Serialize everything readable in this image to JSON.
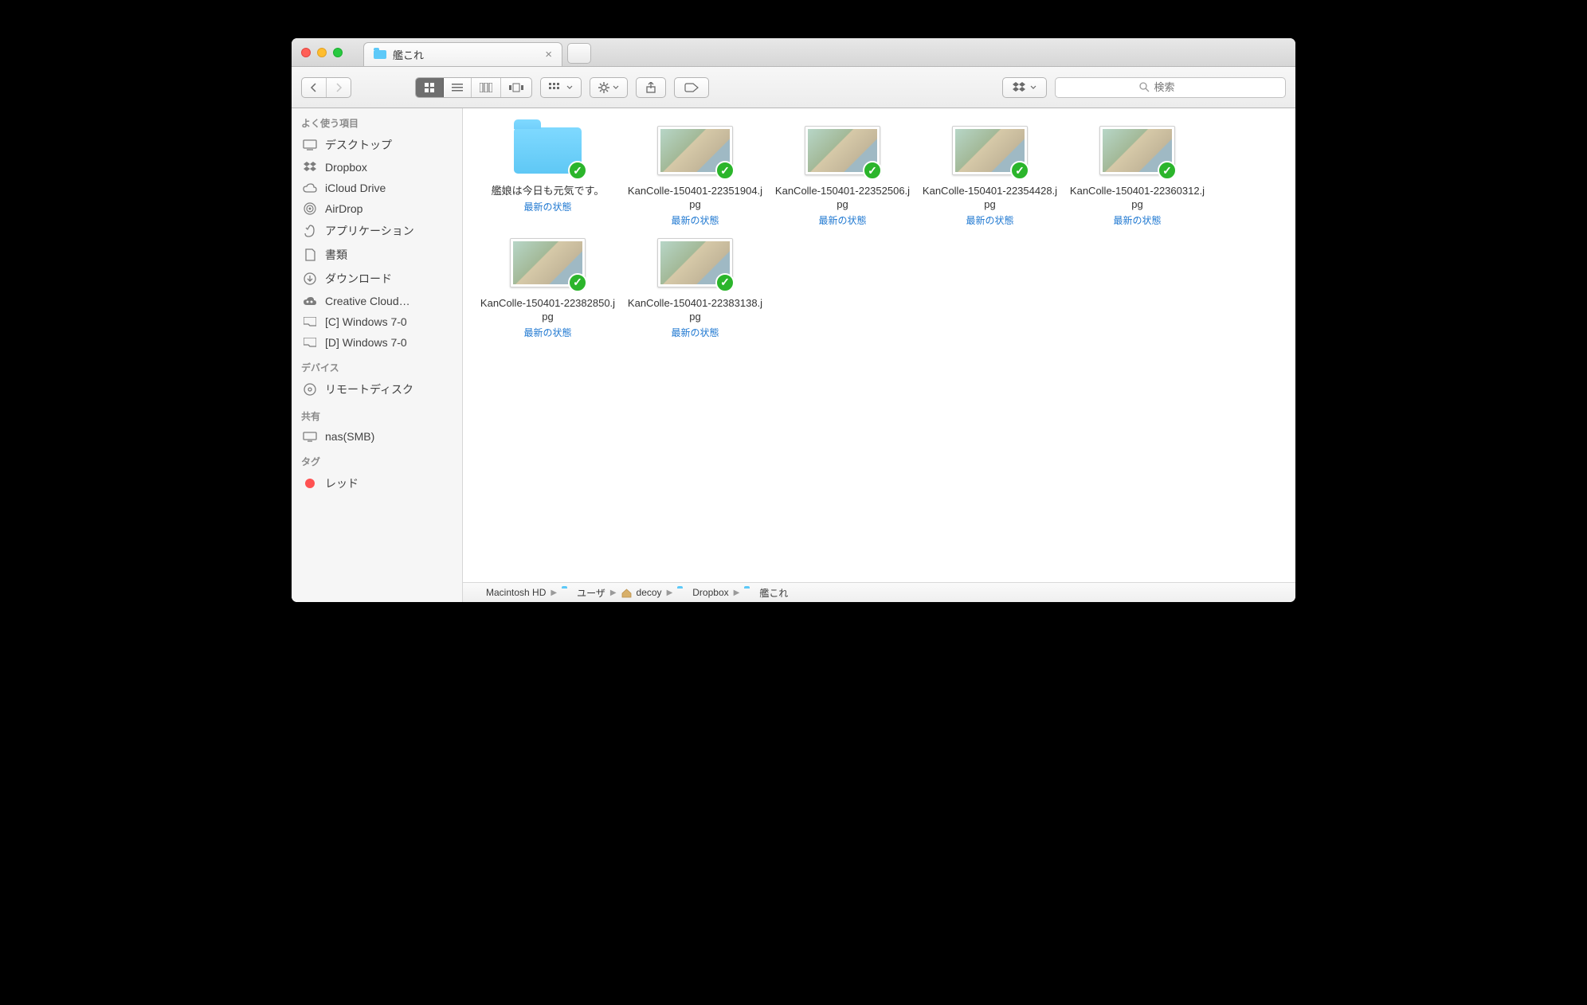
{
  "window": {
    "tab_title": "艦これ"
  },
  "toolbar": {
    "dropbox_label": "",
    "search_placeholder": "検索"
  },
  "sidebar": {
    "sections": [
      {
        "heading": "よく使う項目",
        "items": [
          {
            "label": "デスクトップ",
            "icon": "desktop"
          },
          {
            "label": "Dropbox",
            "icon": "dropbox"
          },
          {
            "label": "iCloud Drive",
            "icon": "cloud"
          },
          {
            "label": "AirDrop",
            "icon": "airdrop"
          },
          {
            "label": "アプリケーション",
            "icon": "apps"
          },
          {
            "label": "書類",
            "icon": "doc"
          },
          {
            "label": "ダウンロード",
            "icon": "download"
          },
          {
            "label": "Creative Cloud…",
            "icon": "cc"
          },
          {
            "label": "[C] Windows 7-0",
            "icon": "folder"
          },
          {
            "label": "[D] Windows 7-0",
            "icon": "folder"
          }
        ]
      },
      {
        "heading": "デバイス",
        "items": [
          {
            "label": "リモートディスク",
            "icon": "disc"
          }
        ]
      },
      {
        "heading": "共有",
        "items": [
          {
            "label": "nas(SMB)",
            "icon": "screen"
          }
        ]
      },
      {
        "heading": "タグ",
        "items": [
          {
            "label": "レッド",
            "icon": "tag-red"
          }
        ]
      }
    ]
  },
  "content": {
    "status_text": "最新の状態",
    "items": [
      {
        "type": "folder",
        "name": "艦娘は今日も元気です。"
      },
      {
        "type": "image",
        "name": "KanColle-150401-22351904.jpg"
      },
      {
        "type": "image",
        "name": "KanColle-150401-22352506.jpg"
      },
      {
        "type": "image",
        "name": "KanColle-150401-22354428.jpg"
      },
      {
        "type": "image",
        "name": "KanColle-150401-22360312.jpg"
      },
      {
        "type": "image",
        "name": "KanColle-150401-22382850.jpg"
      },
      {
        "type": "image",
        "name": "KanColle-150401-22383138.jpg"
      }
    ]
  },
  "pathbar": {
    "crumbs": [
      {
        "label": "Macintosh HD",
        "icon": "disk"
      },
      {
        "label": "ユーザ",
        "icon": "folder"
      },
      {
        "label": "decoy",
        "icon": "home"
      },
      {
        "label": "Dropbox",
        "icon": "folder-db"
      },
      {
        "label": "艦これ",
        "icon": "folder"
      }
    ]
  }
}
